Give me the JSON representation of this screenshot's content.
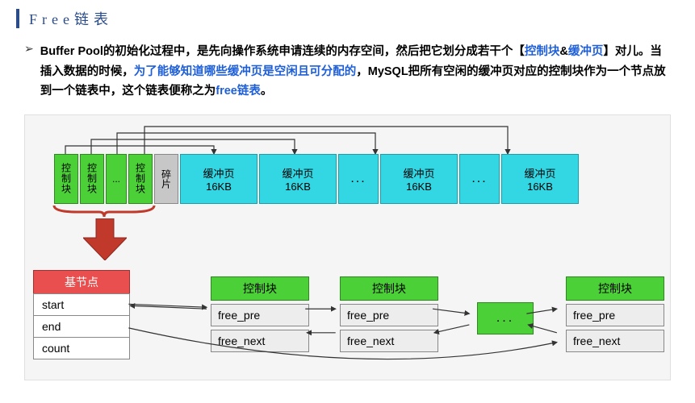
{
  "title": "Free链表",
  "bullet": {
    "marker": "➢",
    "t1": "Buffer Pool的初始化过程中，是先向操作系统申请连续的内存空间，然后把它划分成若干个【",
    "t2": "控制块",
    "amp": "&",
    "t3": "缓冲页",
    "t4": "】对儿。当插入数据的时候，",
    "t5": "为了能够知道哪些缓冲页是空闲且可分配的",
    "t6": "，MySQL把所有空闲的缓冲页对应的控制块作为一个节点放到一个链表中，这个链表便称之为",
    "t7": "free链表",
    "t8": "。"
  },
  "top_blocks": {
    "ctrl_label": "控制块",
    "ellipsis": "...",
    "frag_label": "碎片",
    "page_label": "缓冲页",
    "page_size": "16KB"
  },
  "base_node": {
    "title": "基节点",
    "r1": "start",
    "r2": "end",
    "r3": "count"
  },
  "cb_node": {
    "title": "控制块",
    "r1": "free_pre",
    "r2": "free_next"
  }
}
